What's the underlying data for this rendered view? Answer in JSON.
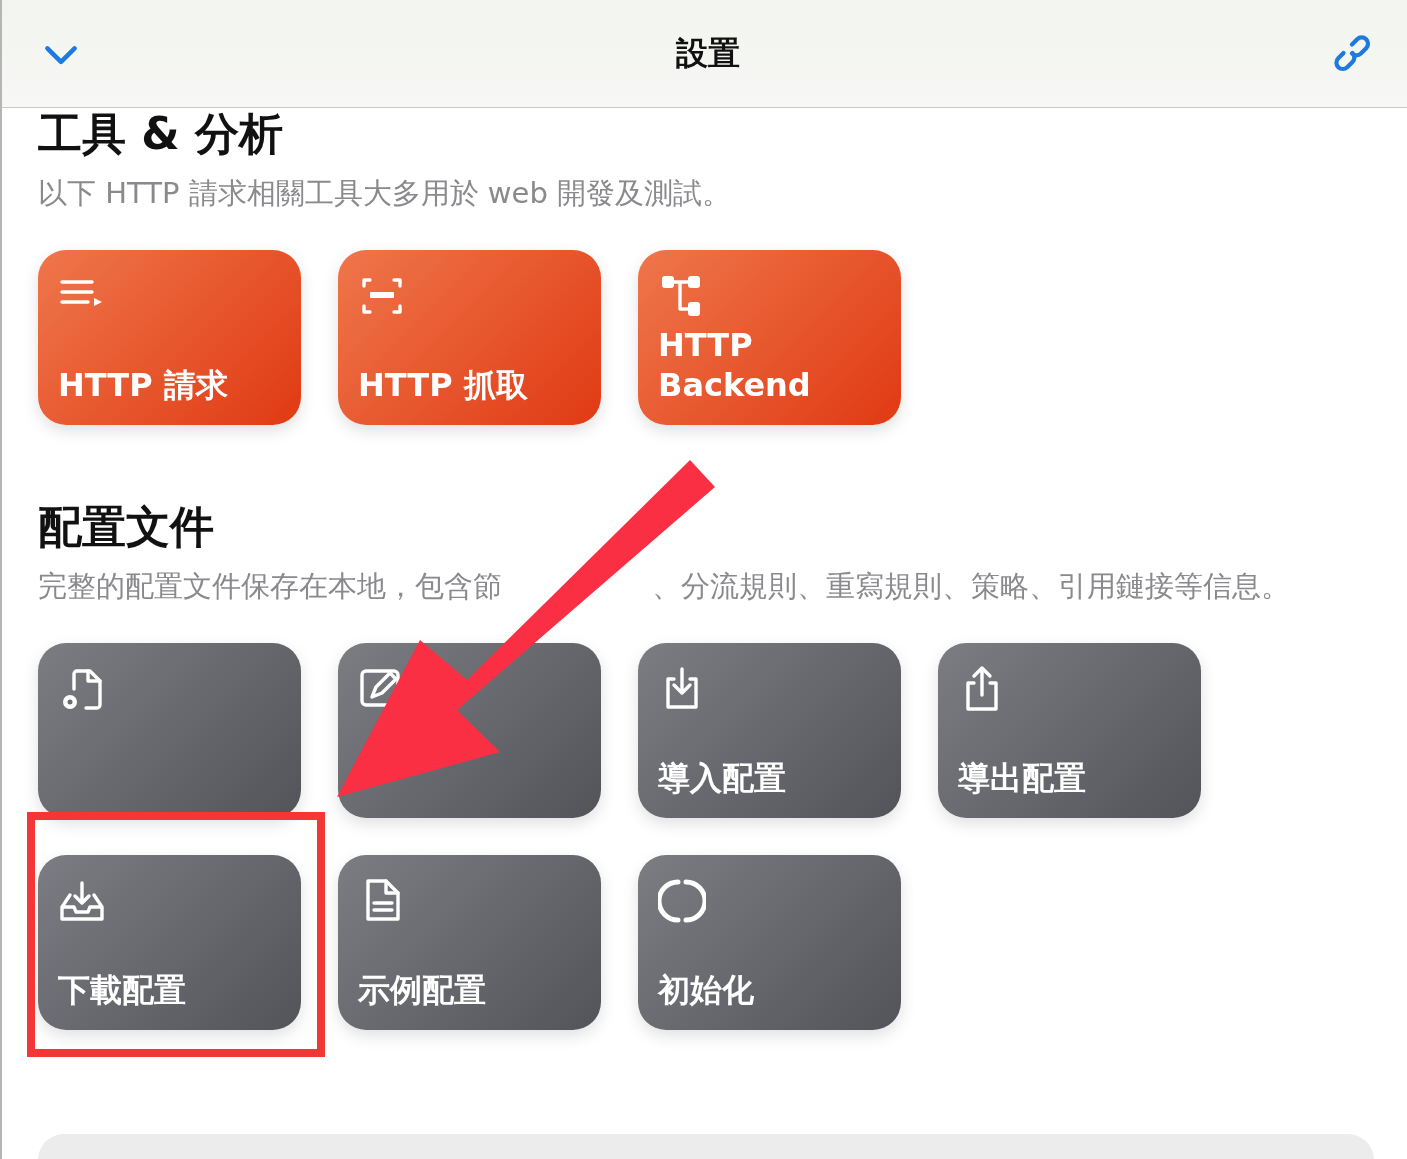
{
  "header": {
    "title": "設置"
  },
  "sections": [
    {
      "title": "工具 & 分析",
      "description": [
        "以下 HTTP 請求相關工具大多用於 web 開發及測試。"
      ],
      "kind": "accent",
      "tiles": [
        {
          "kind": "lines",
          "label": "HTTP 請求"
        },
        {
          "kind": "scan",
          "label": "HTTP 抓取"
        },
        {
          "kind": "tree",
          "label": "HTTP\nBackend"
        }
      ]
    },
    {
      "title": "配置文件",
      "description": [
        "完整的配置文件保存在本地，包含節",
        "、分流規則、重寫規則、策略、引用鏈接等信息。"
      ],
      "kind": "neutral",
      "tiles": [
        {
          "kind": "filegear"
        },
        {
          "kind": "edit"
        },
        {
          "kind": "import",
          "label": "導入配置"
        },
        {
          "kind": "export",
          "label": "導出配置"
        },
        {
          "kind": "inbox",
          "label": "下載配置"
        },
        {
          "kind": "doc",
          "label": "示例配置"
        },
        {
          "kind": "reset",
          "label": "初始化"
        }
      ]
    }
  ]
}
